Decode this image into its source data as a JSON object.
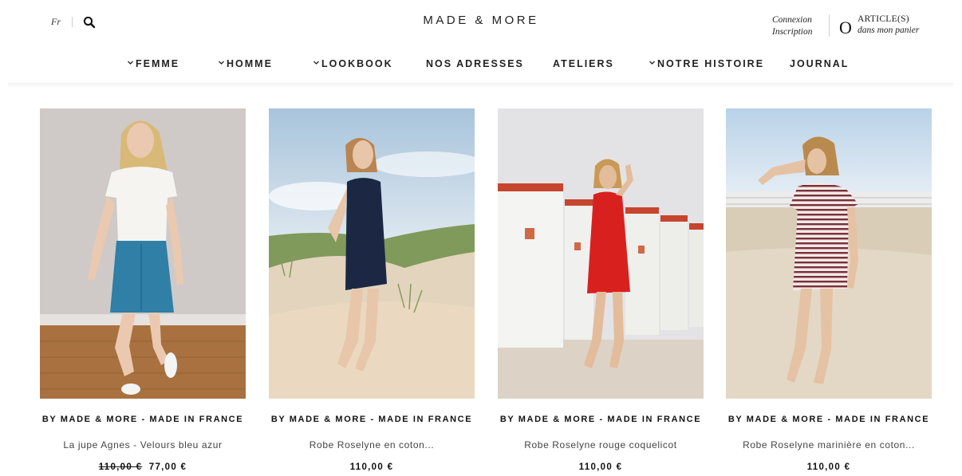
{
  "header": {
    "lang": "Fr",
    "logo": "MADE & MORE",
    "account": {
      "login": "Connexion",
      "register": "Inscription"
    },
    "cart": {
      "count": "O",
      "label_line1": "ARTICLE(S)",
      "label_line2": "dans mon panier"
    }
  },
  "nav": [
    {
      "label": "FEMME",
      "has_dropdown": true
    },
    {
      "label": "HOMME",
      "has_dropdown": true
    },
    {
      "label": "LOOKBOOK",
      "has_dropdown": true
    },
    {
      "label": "NOS ADRESSES",
      "has_dropdown": false
    },
    {
      "label": "ATELIERS",
      "has_dropdown": false
    },
    {
      "label": "NOTRE HISTOIRE",
      "has_dropdown": true
    },
    {
      "label": "JOURNAL",
      "has_dropdown": false
    }
  ],
  "products": [
    {
      "brand": "BY MADE & MORE - MADE IN FRANCE",
      "name": "La jupe Agnes - Velours bleu azur",
      "old_price": "110,00 €",
      "price": "77,00 €"
    },
    {
      "brand": "BY MADE & MORE - MADE IN FRANCE",
      "name": "Robe Roselyne en coton...",
      "old_price": "",
      "price": "110,00 €"
    },
    {
      "brand": "BY MADE & MORE - MADE IN FRANCE",
      "name": "Robe Roselyne rouge coquelicot",
      "old_price": "",
      "price": "110,00 €"
    },
    {
      "brand": "BY MADE & MORE - MADE IN FRANCE",
      "name": "Robe Roselyne marinière en coton...",
      "old_price": "",
      "price": "110,00 €"
    }
  ],
  "colors": {
    "text": "#1a1a1a",
    "skirt_blue": "#2f7fa6",
    "dress_navy": "#1c2744",
    "dress_red": "#d8211e",
    "sand": "#d9cdb8"
  }
}
